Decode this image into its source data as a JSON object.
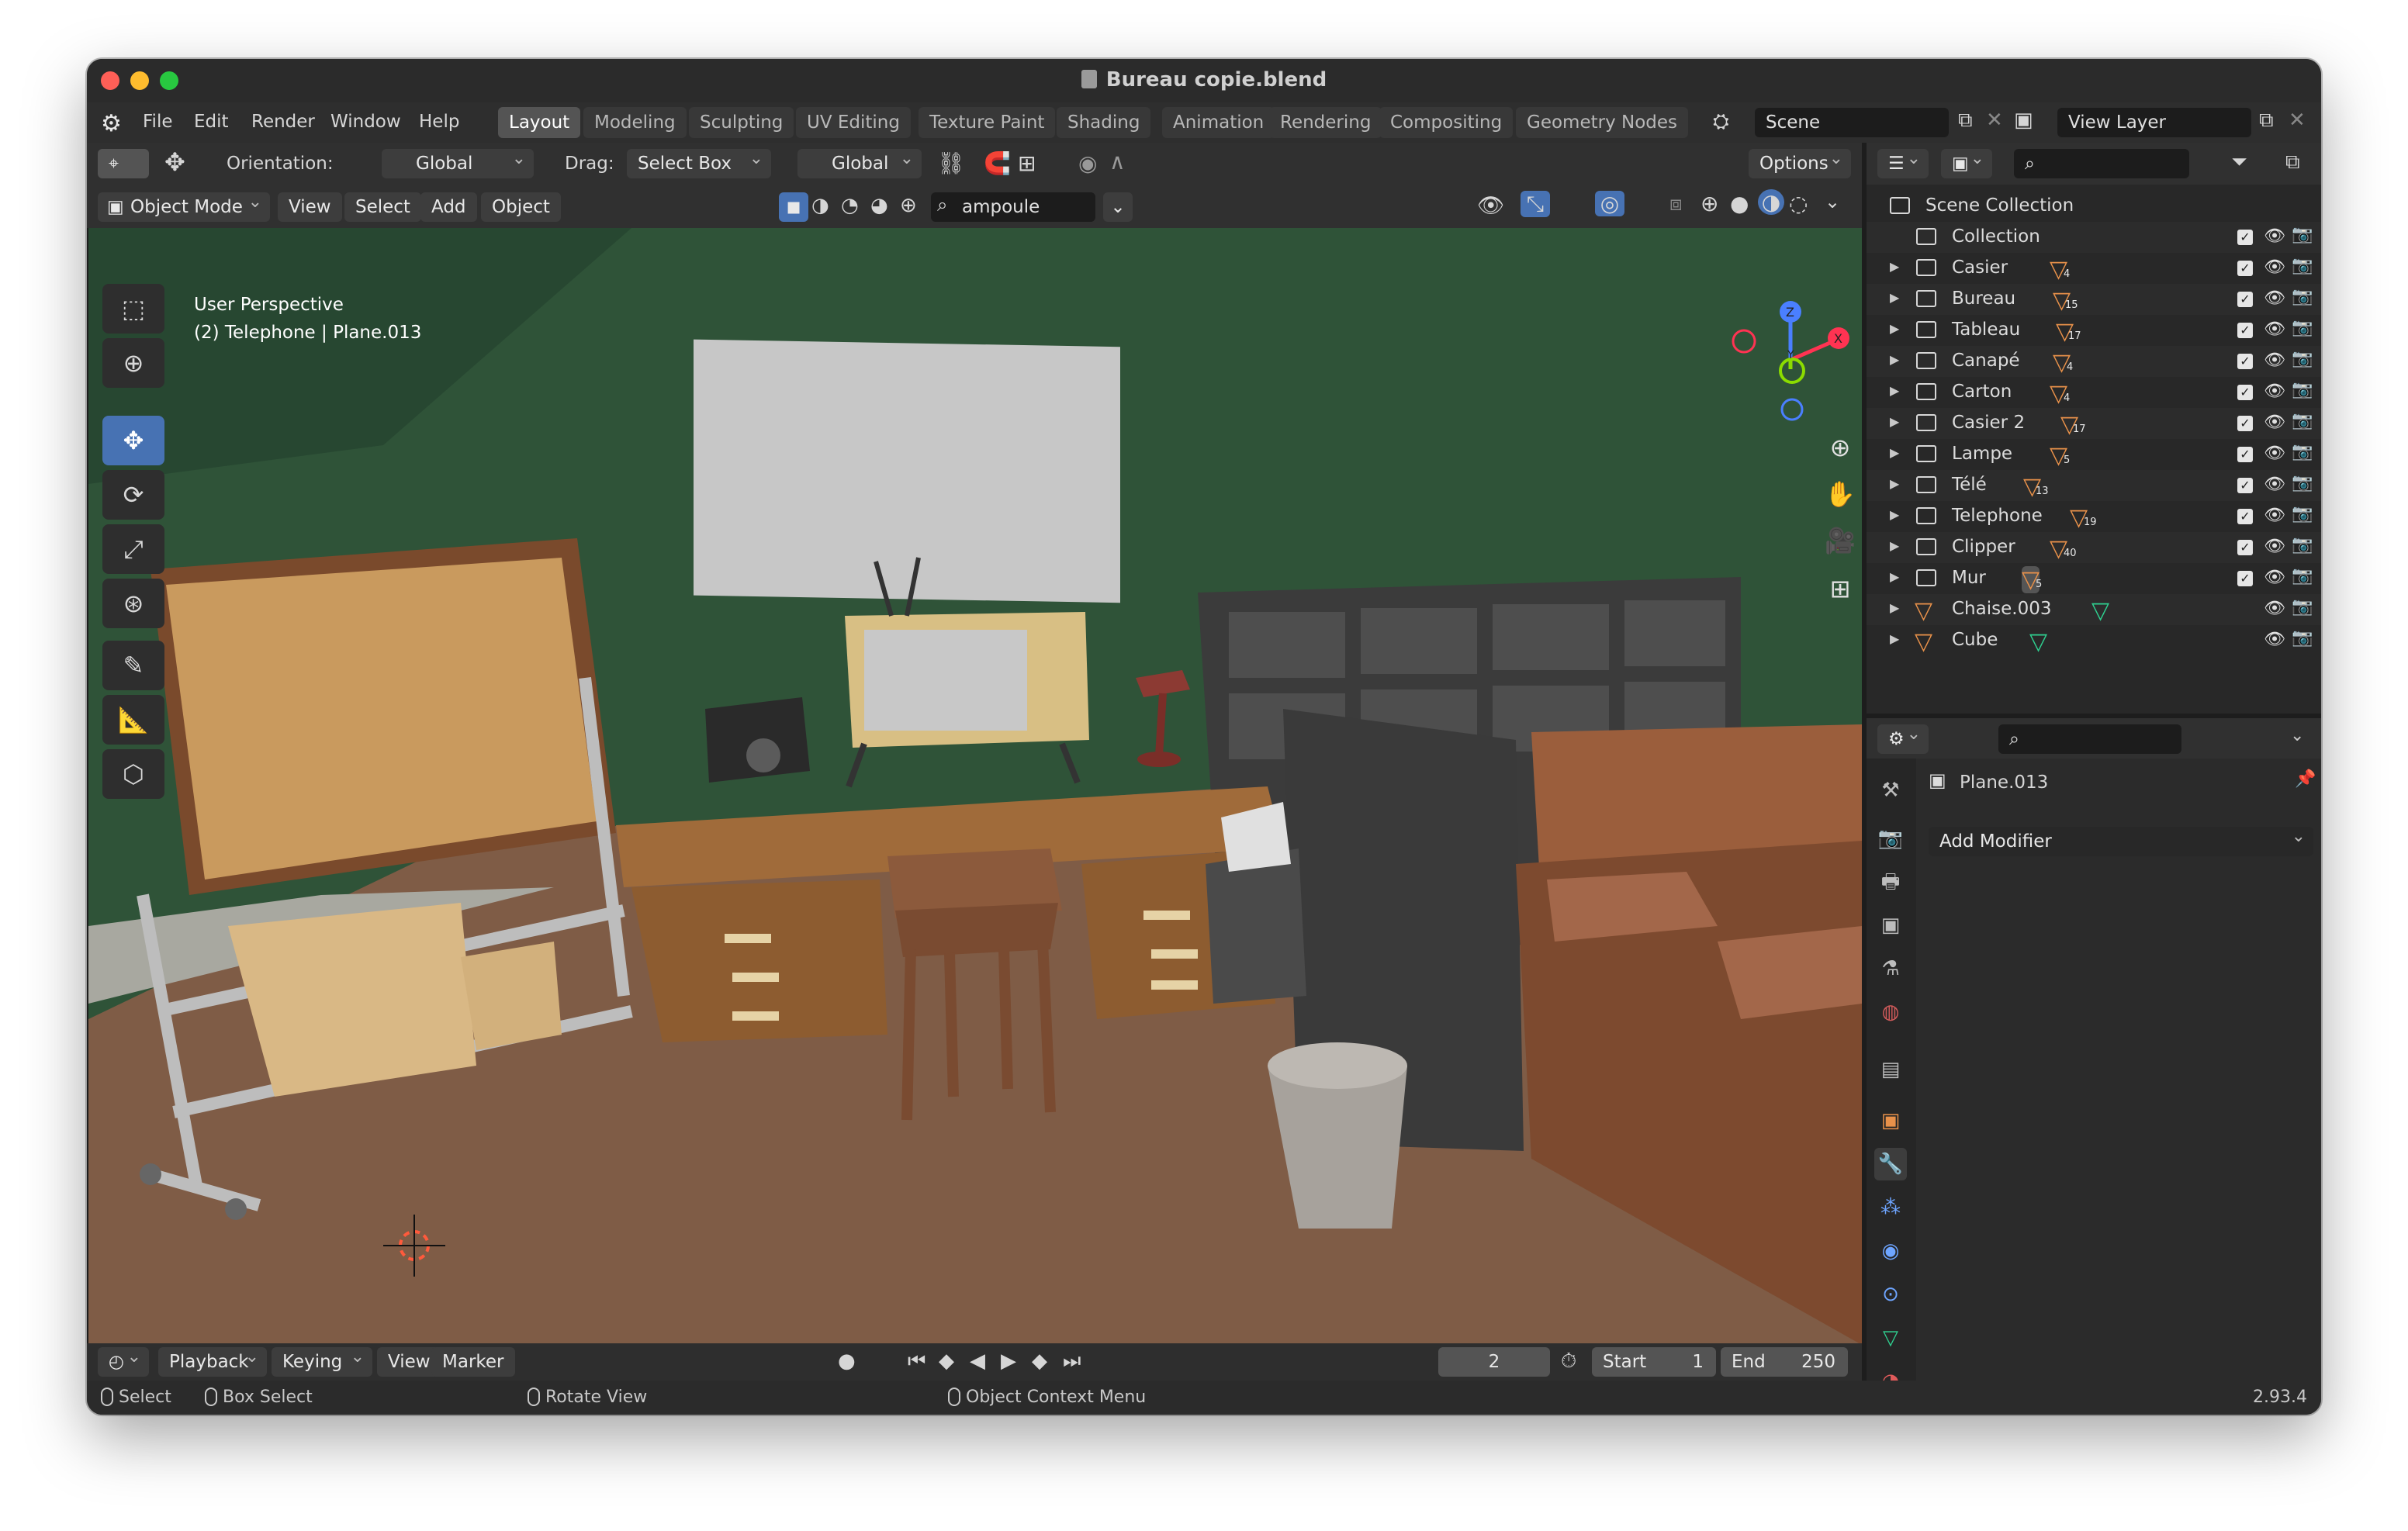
{
  "window": {
    "title": "Bureau copie.blend"
  },
  "menu": [
    "File",
    "Edit",
    "Render",
    "Window",
    "Help"
  ],
  "workspace_tabs": [
    {
      "label": "Layout",
      "active": true
    },
    {
      "label": "Modeling"
    },
    {
      "label": "Sculpting"
    },
    {
      "label": "UV Editing"
    },
    {
      "label": "Texture Paint"
    },
    {
      "label": "Shading"
    },
    {
      "label": "Animation"
    },
    {
      "label": "Rendering"
    },
    {
      "label": "Compositing"
    },
    {
      "label": "Geometry Nodes"
    }
  ],
  "scene": {
    "value": "Scene"
  },
  "view_layer": {
    "value": "View Layer"
  },
  "tool_header": {
    "orientation_label": "Orientation:",
    "orientation_value": "Global",
    "drag_label": "Drag:",
    "drag_value": "Select Box",
    "transform_value": "Global",
    "options_label": "Options"
  },
  "viewport_header": {
    "mode": "Object Mode",
    "menus": [
      "View",
      "Select",
      "Add",
      "Object"
    ],
    "search_value": "ampoule"
  },
  "viewport": {
    "perspective": "User Perspective",
    "active_info": "(2) Telephone | Plane.013"
  },
  "gizmo": {
    "x": "X",
    "y": "Y",
    "z": "Z"
  },
  "outliner": {
    "root": "Scene Collection",
    "items": [
      {
        "name": "Collection",
        "type": "collection"
      },
      {
        "name": "Casier",
        "count": "4",
        "type": "collection"
      },
      {
        "name": "Bureau",
        "count": "15",
        "type": "collection"
      },
      {
        "name": "Tableau",
        "count": "17",
        "type": "collection"
      },
      {
        "name": "Canapé",
        "count": "4",
        "type": "collection"
      },
      {
        "name": "Carton",
        "count": "4",
        "type": "collection"
      },
      {
        "name": "Casier 2",
        "count": "17",
        "type": "collection"
      },
      {
        "name": "Lampe",
        "count": "5",
        "type": "collection"
      },
      {
        "name": "Télé",
        "count": "13",
        "type": "collection"
      },
      {
        "name": "Telephone",
        "count": "19",
        "type": "collection"
      },
      {
        "name": "Clipper",
        "count": "40",
        "type": "collection"
      },
      {
        "name": "Mur",
        "count": "5",
        "type": "collection"
      },
      {
        "name": "Chaise.003",
        "type": "mesh"
      },
      {
        "name": "Cube",
        "type": "mesh"
      }
    ]
  },
  "properties": {
    "object_name": "Plane.013",
    "add_modifier": "Add Modifier"
  },
  "timeline": {
    "menus": [
      "Playback",
      "Keying",
      "View",
      "Marker"
    ],
    "current_frame": "2",
    "start_label": "Start",
    "start_value": "1",
    "end_label": "End",
    "end_value": "250"
  },
  "statusbar": {
    "select": "Select",
    "box_select": "Box Select",
    "rotate_view": "Rotate View",
    "context_menu": "Object Context Menu",
    "version": "2.93.4"
  },
  "colors": {
    "accent": "#4772b3",
    "wall": "#2f5338",
    "floor": "#7f5c46",
    "collection_icon": "#e8914a",
    "mesh_icon": "#2fcf8f"
  }
}
